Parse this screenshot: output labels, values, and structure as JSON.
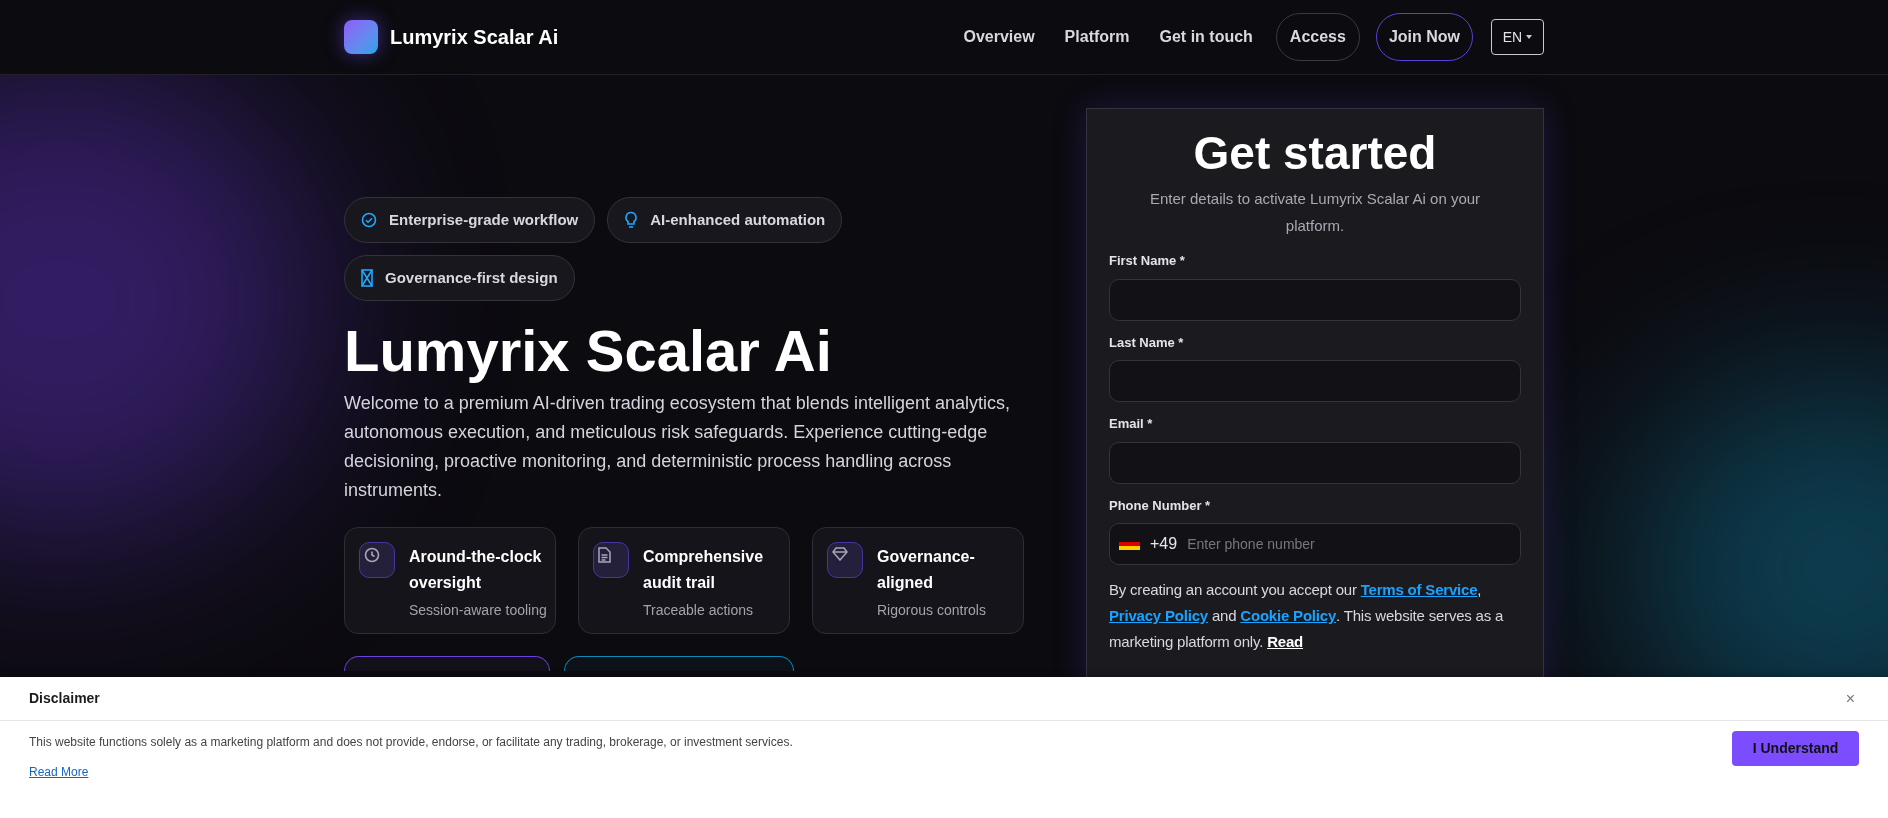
{
  "header": {
    "logo_text": "Lumyrix Scalar Ai",
    "nav": [
      {
        "label": "Overview",
        "kind": "link"
      },
      {
        "label": "Platform",
        "kind": "link"
      },
      {
        "label": "Get in touch",
        "kind": "link"
      },
      {
        "label": "Access",
        "kind": "outline"
      },
      {
        "label": "Join Now",
        "kind": "accent"
      }
    ],
    "language": "EN"
  },
  "hero": {
    "badges": [
      "Enterprise-grade workflow",
      "AI-enhanced automation",
      "Governance-first design"
    ],
    "title": "Lumyrix Scalar Ai",
    "description": "Welcome to a premium AI-driven trading ecosystem that blends intelligent analytics, autonomous execution, and meticulous risk safeguards. Experience cutting-edge decisioning, proactive monitoring, and deterministic process handling across instruments.",
    "features": [
      {
        "title": "Around-the-clock oversight",
        "subtitle": "Session-aware tooling"
      },
      {
        "title": "Comprehensive audit trail",
        "subtitle": "Traceable actions"
      },
      {
        "title": "Governance-aligned",
        "subtitle": "Rigorous controls"
      }
    ],
    "cta_buttons": [
      {
        "kind": "primary"
      },
      {
        "kind": "secondary"
      }
    ]
  },
  "form": {
    "title": "Get started",
    "subtitle": "Enter details to activate Lumyrix Scalar Ai on your platform.",
    "fields": [
      {
        "label": "First Name *",
        "kind": "text"
      },
      {
        "label": "Last Name *",
        "kind": "text"
      },
      {
        "label": "Email *",
        "kind": "text"
      },
      {
        "label": "Phone Number *",
        "kind": "phone",
        "dial_code": "+49",
        "placeholder": "Enter phone number"
      }
    ],
    "consent": [
      {
        "kind": "text",
        "text": "By creating an account you accept our "
      },
      {
        "kind": "link",
        "text": "Terms of Service"
      },
      {
        "kind": "text",
        "text": ", "
      },
      {
        "kind": "link",
        "text": "Privacy Policy"
      },
      {
        "kind": "text",
        "text": " and "
      },
      {
        "kind": "link",
        "text": "Cookie Policy"
      },
      {
        "kind": "text",
        "text": ". This website serves as a marketing platform only. "
      },
      {
        "kind": "strong_link",
        "text": "Read"
      }
    ]
  },
  "disclaimer": {
    "title": "Disclaimer",
    "close": "×",
    "text": "This website functions solely as a marketing platform and does not provide, endorse, or facilitate any trading, brokerage, or investment services.",
    "link": "Read More",
    "button": "I Understand"
  }
}
